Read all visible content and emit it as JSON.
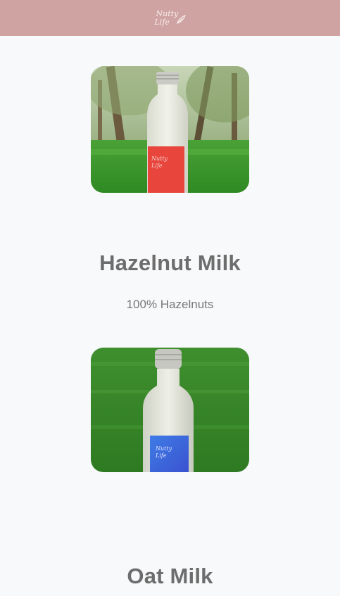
{
  "header": {
    "logo_line1": "Nutty",
    "logo_line2": "Life",
    "background": "#cfa3a1"
  },
  "products": [
    {
      "name": "Hazelnut Milk",
      "description": "100% Hazelnuts",
      "label_color": "#e8453c",
      "label_text_line1": "Nutty",
      "label_text_line2": "Life"
    },
    {
      "name": "Oat Milk",
      "label_color": "#3b6ee0",
      "label_text_line1": "Nutty",
      "label_text_line2": "Life"
    }
  ]
}
